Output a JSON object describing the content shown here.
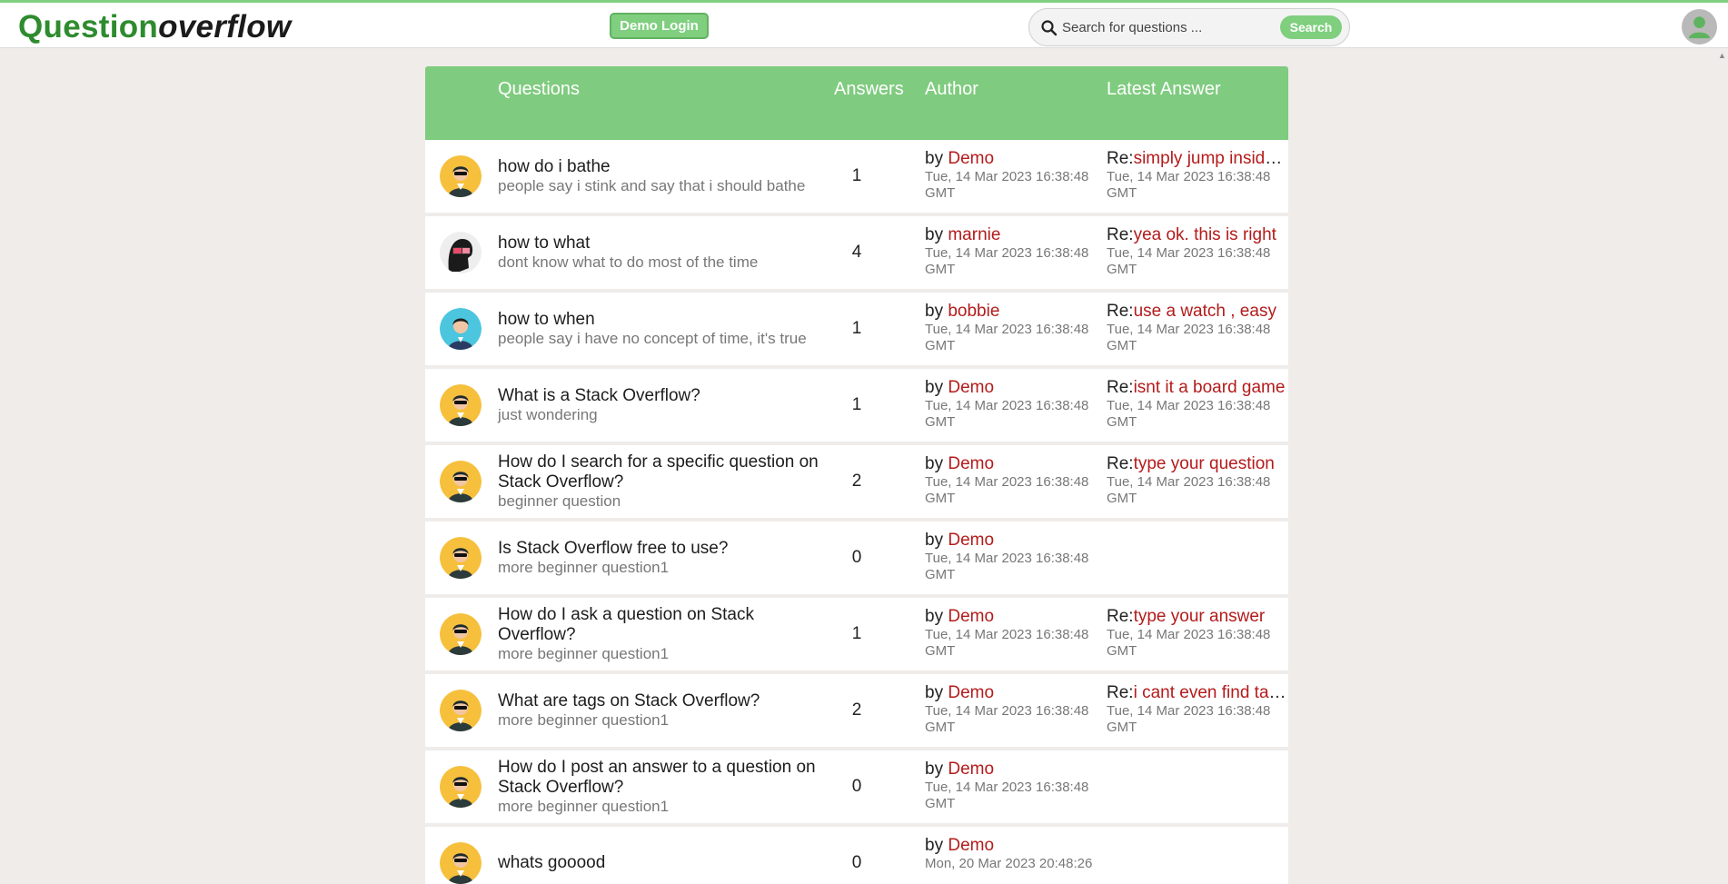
{
  "header": {
    "logo_part1": "Question",
    "logo_part2": "overflow",
    "demo_login": "Demo Login",
    "search_placeholder": "Search for questions ...",
    "search_button": "Search"
  },
  "table": {
    "headers": {
      "questions": "Questions",
      "answers": "Answers",
      "author": "Author",
      "latest": "Latest Answer"
    },
    "by_prefix": "by ",
    "re_prefix": "Re:",
    "rows": [
      {
        "avatar": "demo",
        "title": "how do i bathe",
        "desc": "people say i stink and say that i should bathe",
        "count": "1",
        "author": "Demo",
        "date": "Tue, 14 Mar 2023 16:38:48 GMT",
        "latest": "simply jump inside the shower",
        "latest_date": "Tue, 14 Mar 2023 16:38:48 GMT"
      },
      {
        "avatar": "marnie",
        "title": "how to what",
        "desc": "dont know what to do most of the time",
        "count": "4",
        "author": "marnie",
        "date": "Tue, 14 Mar 2023 16:38:48 GMT",
        "latest": "yea ok. this is right",
        "latest_date": "Tue, 14 Mar 2023 16:38:48 GMT"
      },
      {
        "avatar": "bobbie",
        "title": "how to when",
        "desc": "people say i have no concept of time, it's true",
        "count": "1",
        "author": "bobbie",
        "date": "Tue, 14 Mar 2023 16:38:48 GMT",
        "latest": "use a watch , easy",
        "latest_date": "Tue, 14 Mar 2023 16:38:48 GMT"
      },
      {
        "avatar": "demo",
        "title": "What is a Stack Overflow?",
        "desc": "just wondering",
        "count": "1",
        "author": "Demo",
        "date": "Tue, 14 Mar 2023 16:38:48 GMT",
        "latest": "isnt it a board game",
        "latest_date": "Tue, 14 Mar 2023 16:38:48 GMT"
      },
      {
        "avatar": "demo",
        "title": "How do I search for a specific question on Stack Overflow?",
        "desc": "beginner question",
        "count": "2",
        "author": "Demo",
        "date": "Tue, 14 Mar 2023 16:38:48 GMT",
        "latest": "type your question",
        "latest_date": "Tue, 14 Mar 2023 16:38:48 GMT"
      },
      {
        "avatar": "demo",
        "title": "Is Stack Overflow free to use?",
        "desc": "more beginner question1",
        "count": "0",
        "author": "Demo",
        "date": "Tue, 14 Mar 2023 16:38:48 GMT",
        "latest": "",
        "latest_date": ""
      },
      {
        "avatar": "demo",
        "title": "How do I ask a question on Stack Overflow?",
        "desc": "more beginner question1",
        "count": "1",
        "author": "Demo",
        "date": "Tue, 14 Mar 2023 16:38:48 GMT",
        "latest": "type your answer",
        "latest_date": "Tue, 14 Mar 2023 16:38:48 GMT"
      },
      {
        "avatar": "demo",
        "title": "What are tags on Stack Overflow?",
        "desc": "more beginner question1",
        "count": "2",
        "author": "Demo",
        "date": "Tue, 14 Mar 2023 16:38:48 GMT",
        "latest": "i cant even find tags",
        "latest_date": "Tue, 14 Mar 2023 16:38:48 GMT"
      },
      {
        "avatar": "demo",
        "title": "How do I post an answer to a question on Stack Overflow?",
        "desc": "more beginner question1",
        "count": "0",
        "author": "Demo",
        "date": "Tue, 14 Mar 2023 16:38:48 GMT",
        "latest": "",
        "latest_date": ""
      },
      {
        "avatar": "demo",
        "title": "whats gooood",
        "desc": "",
        "count": "0",
        "author": "Demo",
        "date": "Mon, 20 Mar 2023 20:48:26",
        "latest": "",
        "latest_date": ""
      }
    ]
  },
  "colors": {
    "accent": "#7fcf7f",
    "link": "#b41b1b",
    "background": "#efecea"
  }
}
